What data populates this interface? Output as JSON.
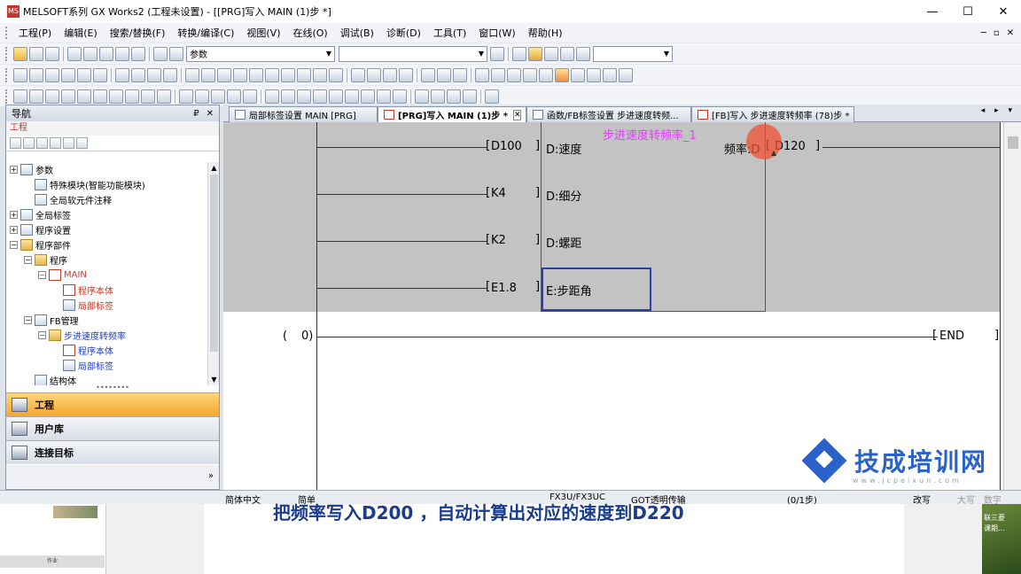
{
  "window": {
    "title": "MELSOFT系列 GX Works2 (工程未设置) - [[PRG]写入 MAIN (1)步 *]",
    "app_icon": "MS",
    "minimize": "—",
    "maximize": "☐",
    "close": "✕"
  },
  "menu": {
    "items": [
      "工程(P)",
      "编辑(E)",
      "搜索/替换(F)",
      "转换/编译(C)",
      "视图(V)",
      "在线(O)",
      "调试(B)",
      "诊断(D)",
      "工具(T)",
      "窗口(W)",
      "帮助(H)"
    ],
    "mdi_restore": "▫",
    "mdi_min": "─",
    "mdi_close": "✕"
  },
  "toolbar1": {
    "param_select": "参数"
  },
  "nav": {
    "title": "导航",
    "pin": "₽",
    "close": "✕",
    "section": "工程",
    "tree": [
      {
        "label": "参数",
        "indent": 0,
        "exp": "+",
        "kind": "icon"
      },
      {
        "label": "特殊模块(智能功能模块)",
        "indent": 1,
        "exp": "",
        "kind": "icon"
      },
      {
        "label": "全局软元件注释",
        "indent": 1,
        "exp": "",
        "kind": "icon"
      },
      {
        "label": "全局标签",
        "indent": 0,
        "exp": "+",
        "kind": "icon"
      },
      {
        "label": "程序设置",
        "indent": 0,
        "exp": "+",
        "kind": "icon"
      },
      {
        "label": "程序部件",
        "indent": 0,
        "exp": "−",
        "kind": "folder"
      },
      {
        "label": "程序",
        "indent": 1,
        "exp": "−",
        "kind": "folder"
      },
      {
        "label": "MAIN",
        "indent": 2,
        "exp": "−",
        "kind": "doc",
        "style": "active"
      },
      {
        "label": "程序本体",
        "indent": 3,
        "exp": "",
        "kind": "doc",
        "style": "active"
      },
      {
        "label": "局部标签",
        "indent": 3,
        "exp": "",
        "kind": "icon",
        "style": "active"
      },
      {
        "label": "FB管理",
        "indent": 1,
        "exp": "−",
        "kind": "icon"
      },
      {
        "label": "步进速度转频率",
        "indent": 2,
        "exp": "−",
        "kind": "folder",
        "style": "blue"
      },
      {
        "label": "程序本体",
        "indent": 3,
        "exp": "",
        "kind": "doc",
        "style": "blue"
      },
      {
        "label": "局部标签",
        "indent": 3,
        "exp": "",
        "kind": "icon",
        "style": "blue"
      },
      {
        "label": "结构体",
        "indent": 1,
        "exp": "",
        "kind": "icon"
      }
    ],
    "pane_buttons": [
      "工程",
      "用户库",
      "连接目标"
    ],
    "more": "»",
    "splitter": "••••••••"
  },
  "tabs": [
    {
      "label": "局部标签设置 MAIN [PRG]",
      "active": false
    },
    {
      "label": "[PRG]写入 MAIN (1)步 *",
      "active": true
    },
    {
      "label": "函数/FB标签设置 步进速度转频...",
      "active": false
    },
    {
      "label": "[FB]写入 步进速度转频率 (78)步 *",
      "active": false
    }
  ],
  "tab_close": "✕",
  "tab_scroll": "◂ ▸ ▾",
  "ladder": {
    "fb_instance": "步进速度转频率_1",
    "inputs": [
      {
        "operand": "D100",
        "pin": "D:速度"
      },
      {
        "operand": "K4",
        "pin": "D:细分"
      },
      {
        "operand": "K2",
        "pin": "D:螺距"
      },
      {
        "operand": "E1.8",
        "pin": "E:步距角"
      }
    ],
    "output_pin": "频率:D",
    "output_operand": "D120",
    "end_step_open": "(",
    "end_step": "0)",
    "end_instruction": "END",
    "bracket_l": "[",
    "bracket_r": "]"
  },
  "watermark": {
    "name": "技成培训网",
    "url": "www.jcpeixun.com",
    "color": "#2a62c9"
  },
  "status": {
    "language": "简体中文",
    "mode": "简单",
    "plc": "FX3U/FX3UC",
    "connection": "GOT透明传输",
    "steps": "(0/1步)",
    "edit_mode": "改写",
    "caps": "大写",
    "num": "数字"
  },
  "background": {
    "slide_text": "把频率写入D200 ，自动计算出对应的速度到D220",
    "thumb_label": "作业",
    "side_text_1": "联三菱",
    "side_text_2": "课期..."
  }
}
